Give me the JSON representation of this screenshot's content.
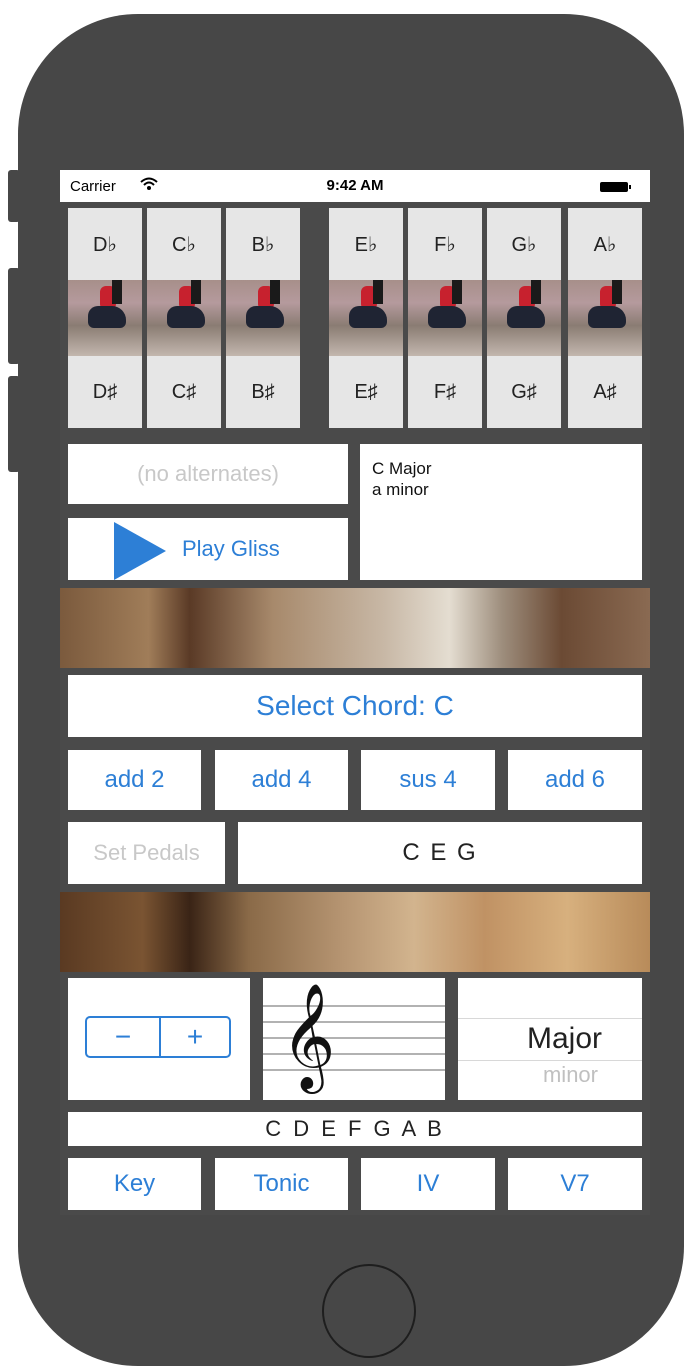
{
  "status_bar": {
    "carrier": "Carrier",
    "time": "9:42 AM"
  },
  "pedals": {
    "flats": [
      "D♭",
      "C♭",
      "B♭",
      "E♭",
      "F♭",
      "G♭",
      "A♭"
    ],
    "sharps": [
      "D♯",
      "C♯",
      "B♯",
      "E♯",
      "F♯",
      "G♯",
      "A♯"
    ]
  },
  "alternates_label": "(no alternates)",
  "play_gliss_label": "Play Gliss",
  "chord_info": {
    "line1": "C Major",
    "line2": "a minor"
  },
  "select_chord_label": "Select Chord: C",
  "modifiers": [
    "add 2",
    "add 4",
    "sus 4",
    "add 6"
  ],
  "set_pedals_label": "Set Pedals",
  "chord_notes": "C E G",
  "stepper": {
    "minus": "−",
    "plus": "+"
  },
  "clef_symbol": "𝄞",
  "mode_picker": {
    "selected": "Major",
    "next": "minor"
  },
  "scale_notes": "C D E F G A B",
  "bottom_buttons": [
    "Key",
    "Tonic",
    "IV",
    "V7"
  ],
  "colors": {
    "accent": "#2d7fd6",
    "phone_body": "#474747",
    "disabled_text": "#c8c8c8"
  }
}
